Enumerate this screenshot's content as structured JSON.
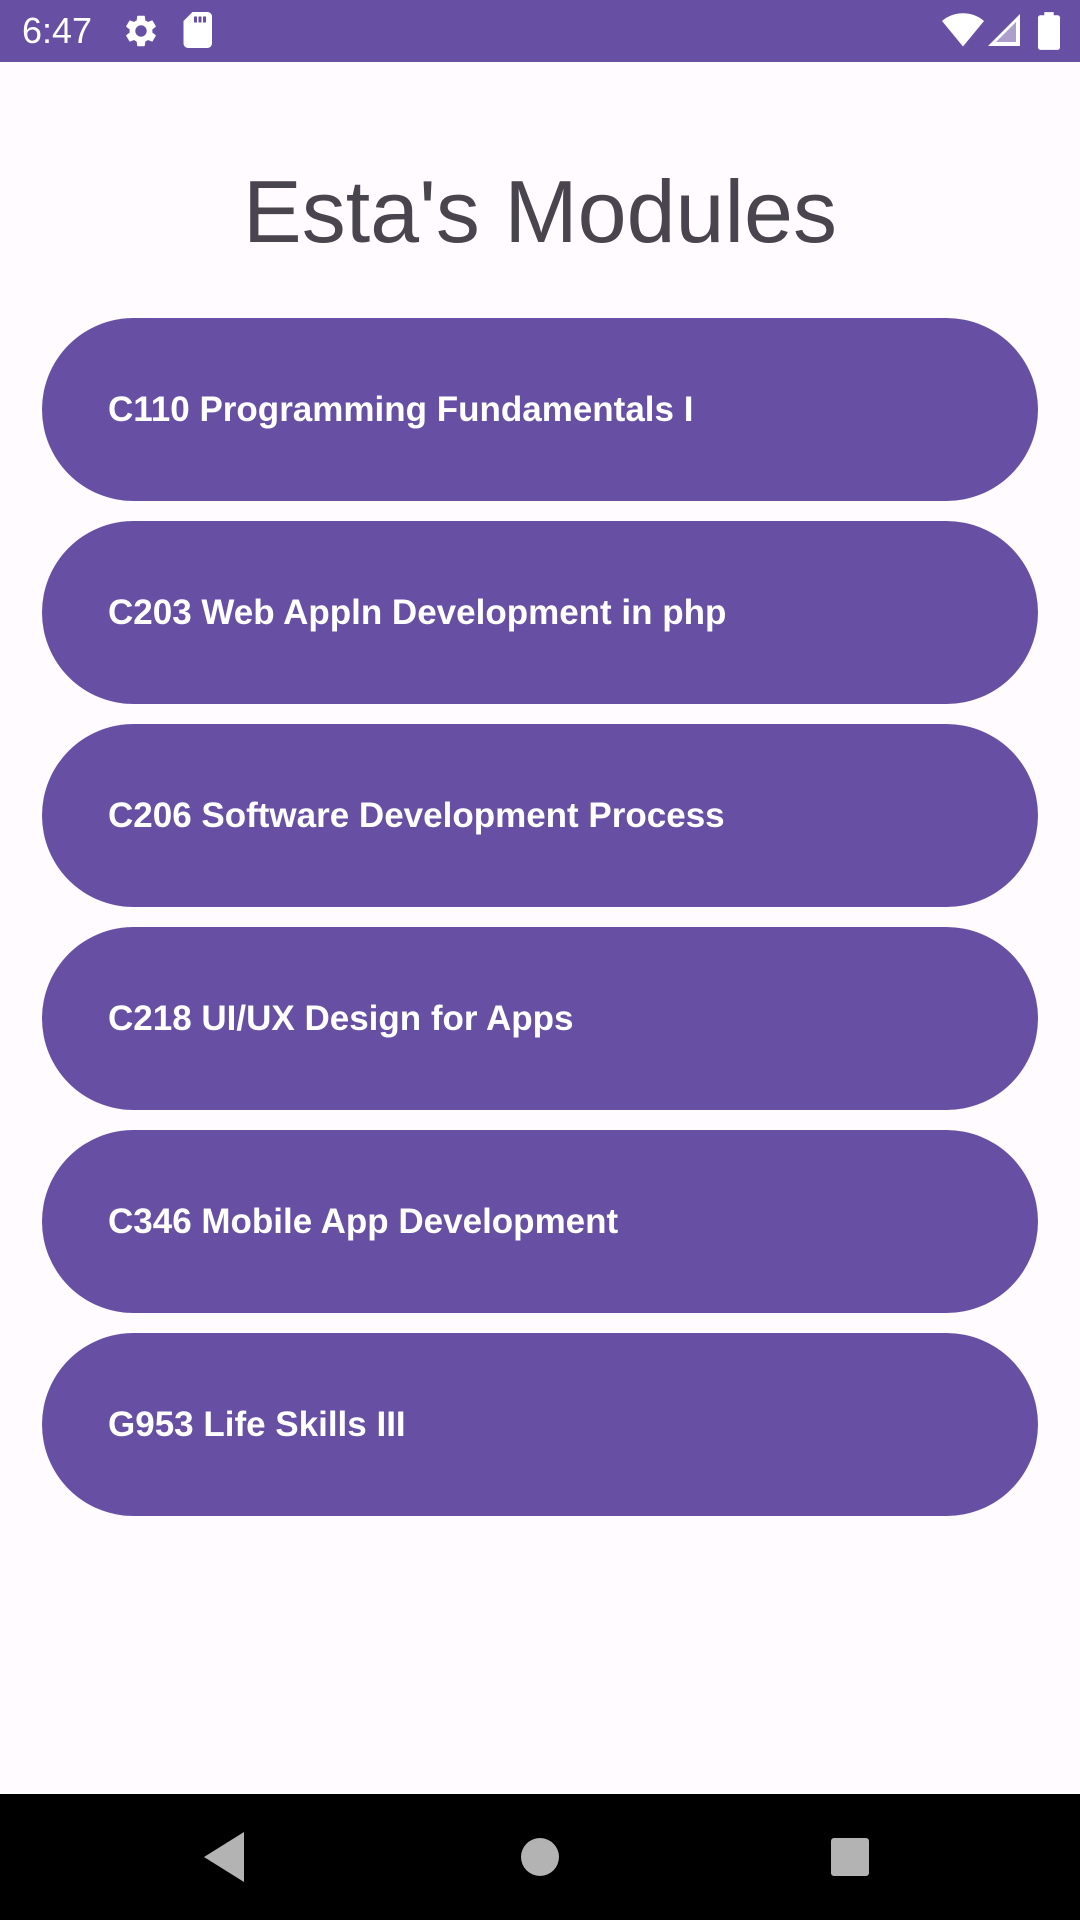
{
  "status_bar": {
    "time": "6:47",
    "icons": [
      "settings-gear-icon",
      "sd-card-icon",
      "wifi-icon",
      "cell-signal-icon",
      "battery-icon"
    ]
  },
  "page": {
    "title": "Esta's Modules"
  },
  "modules": [
    {
      "label": "C110 Programming Fundamentals I"
    },
    {
      "label": "C203 Web Appln Development in php"
    },
    {
      "label": "C206 Software Development Process"
    },
    {
      "label": "C218 UI/UX Design for Apps"
    },
    {
      "label": "C346 Mobile App Development"
    },
    {
      "label": "G953 Life Skills III"
    }
  ],
  "nav_bar": {
    "icons": [
      "back-triangle-icon",
      "home-circle-icon",
      "recents-square-icon"
    ]
  },
  "colors": {
    "primary": "#6750A4",
    "background": "#FFFBFE",
    "title_text": "#49454F",
    "button_text": "#FFFFFF"
  }
}
